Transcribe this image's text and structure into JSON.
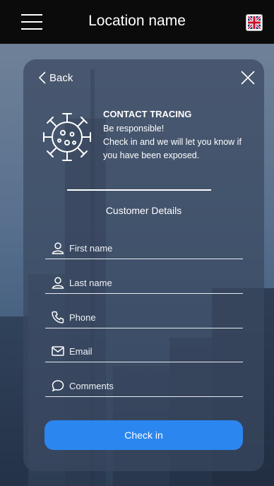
{
  "header": {
    "title": "Location name",
    "language": "United Kingdom flag"
  },
  "nav": {
    "back_label": "Back"
  },
  "tracing": {
    "title": "CONTACT TRACING",
    "line1": "Be responsible!",
    "line2": "Check in and we will let you know if you have been exposed."
  },
  "section": {
    "title": "Customer Details"
  },
  "form": {
    "first_name": {
      "placeholder": "First name",
      "value": ""
    },
    "last_name": {
      "placeholder": "Last name",
      "value": ""
    },
    "phone": {
      "placeholder": "Phone",
      "value": ""
    },
    "email": {
      "placeholder": "Email",
      "value": ""
    },
    "comments": {
      "placeholder": "Comments",
      "value": ""
    }
  },
  "actions": {
    "checkin_label": "Check in"
  },
  "colors": {
    "accent": "#2b86ef",
    "topbar": "#0b0b0b",
    "card": "#3a4860"
  }
}
